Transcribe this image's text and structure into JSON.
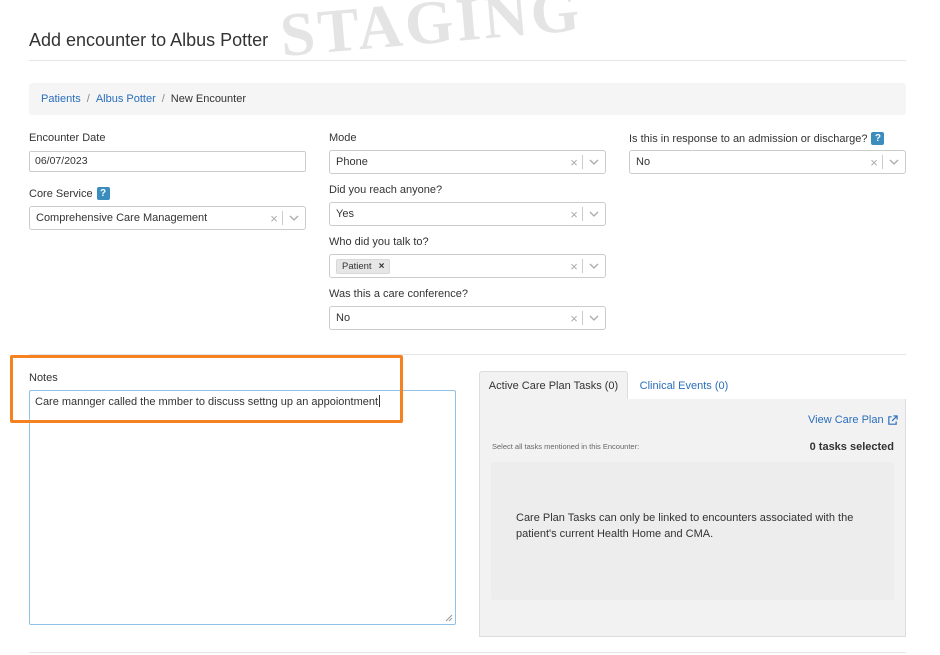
{
  "watermark": "STAGING",
  "page": {
    "title": "Add encounter to Albus Potter"
  },
  "breadcrumb": {
    "items": [
      "Patients",
      "Albus Potter"
    ],
    "separator": "/",
    "current": "New Encounter"
  },
  "form": {
    "encounter_date": {
      "label": "Encounter Date",
      "value": "06/07/2023"
    },
    "core_service": {
      "label": "Core Service",
      "value": "Comprehensive Care Management"
    },
    "mode": {
      "label": "Mode",
      "value": "Phone"
    },
    "reached_anyone": {
      "label": "Did you reach anyone?",
      "value": "Yes"
    },
    "talked_to": {
      "label": "Who did you talk to?",
      "tags": [
        "Patient"
      ],
      "tag_remove": "×"
    },
    "care_conference": {
      "label": "Was this a care conference?",
      "value": "No"
    },
    "admission_discharge": {
      "label": "Is this in response to an admission or discharge?",
      "value": "No"
    },
    "help_icon": "?",
    "clear_icon": "×"
  },
  "notes": {
    "label": "Notes",
    "value": "Care mannger called the mmber to discuss settng up an appoiontment"
  },
  "tabs": [
    {
      "label": "Active Care Plan Tasks (0)",
      "active": true
    },
    {
      "label": "Clinical Events (0)",
      "active": false
    }
  ],
  "care_plan": {
    "view_link": "View Care Plan",
    "select_all_text": "Select all tasks mentioned in this Encounter:",
    "tasks_selected": "0 tasks selected",
    "info_message": "Care Plan Tasks can only be linked to encounters associated with the patient's current Health Home and CMA."
  },
  "colors": {
    "link": "#2a6ebb",
    "help_badge": "#3a8dbd",
    "highlight": "#f58220",
    "notes_border": "#8fc2e6",
    "panel_bg": "#f2f2f2"
  },
  "icons": [
    "help-icon",
    "clear-icon",
    "chevron-down-icon",
    "external-link-icon",
    "tag-remove-icon"
  ]
}
